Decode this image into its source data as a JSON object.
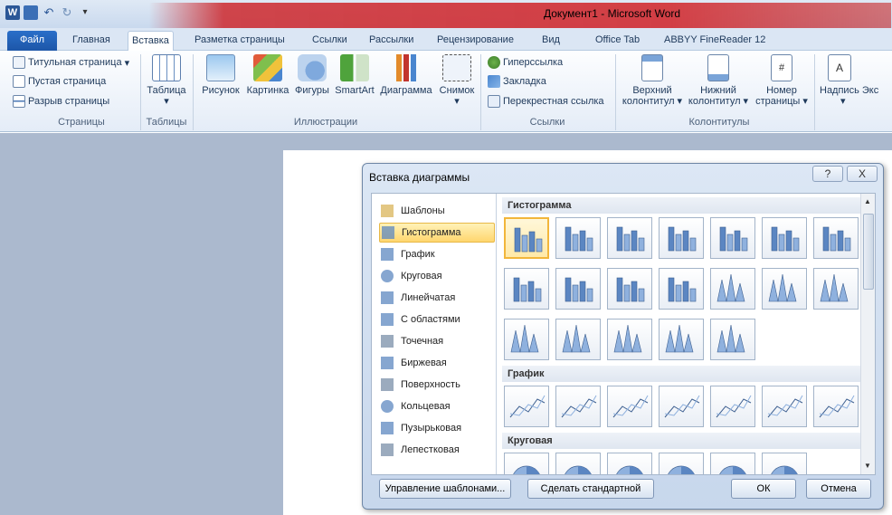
{
  "window": {
    "title": "Документ1 - Microsoft Word"
  },
  "tabs": [
    "Файл",
    "Главная",
    "Вставка",
    "Разметка страницы",
    "Ссылки",
    "Рассылки",
    "Рецензирование",
    "Вид",
    "Office Tab",
    "ABBYY FineReader 12"
  ],
  "ribbon": {
    "pages": {
      "title_page": "Титульная страница",
      "blank_page": "Пустая страница",
      "page_break": "Разрыв страницы",
      "label": "Страницы"
    },
    "tables": {
      "table": "Таблица",
      "label": "Таблицы"
    },
    "illustrations": {
      "picture": "Рисунок",
      "clipart": "Картинка",
      "shapes": "Фигуры",
      "smartart": "SmartArt",
      "chart": "Диаграмма",
      "screenshot": "Снимок",
      "label": "Иллюстрации"
    },
    "links": {
      "hyperlink": "Гиперссылка",
      "bookmark": "Закладка",
      "crossref": "Перекрестная ссылка",
      "label": "Ссылки"
    },
    "headerfooter": {
      "header_l1": "Верхний",
      "header_l2": "колонтитул",
      "footer_l1": "Нижний",
      "footer_l2": "колонтитул",
      "pagenum_l1": "Номер",
      "pagenum_l2": "страницы",
      "label": "Колонтитулы"
    },
    "text": {
      "textbox": "Надпись",
      "express": "Экс"
    }
  },
  "dialog": {
    "title": "Вставка диаграммы",
    "help": "?",
    "close": "X",
    "categories": [
      "Шаблоны",
      "Гистограмма",
      "График",
      "Круговая",
      "Линейчатая",
      "С областями",
      "Точечная",
      "Биржевая",
      "Поверхность",
      "Кольцевая",
      "Пузырьковая",
      "Лепестковая"
    ],
    "selected_category": "Гистограмма",
    "sections": {
      "histogram": "Гистограмма",
      "line": "График",
      "pie": "Круговая"
    },
    "buttons": {
      "manage": "Управление шаблонами...",
      "set_default": "Сделать стандартной",
      "ok": "ОК",
      "cancel": "Отмена"
    }
  }
}
